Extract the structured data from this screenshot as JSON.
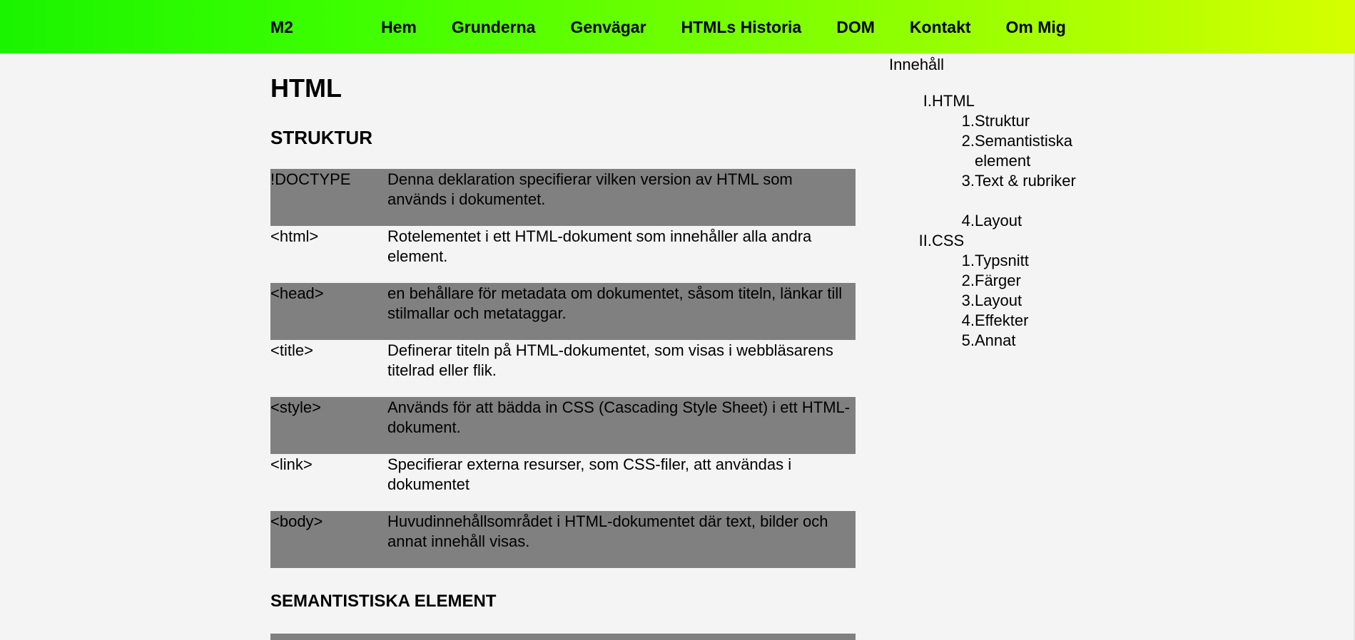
{
  "header": {
    "logo": "M2",
    "nav": [
      "Hem",
      "Grunderna",
      "Genvägar",
      "HTMLs Historia",
      "DOM",
      "Kontakt",
      "Om Mig"
    ]
  },
  "main": {
    "title": "HTML",
    "section1_heading": "STRUKTUR",
    "rows": [
      {
        "tag": "!DOCTYPE",
        "desc": "Denna deklaration specifierar vilken version av HTML som används i dokumentet."
      },
      {
        "tag": "<html>",
        "desc": "Rotelementet i ett HTML-dokument som innehåller alla andra element."
      },
      {
        "tag": "<head>",
        "desc": "en behållare för metadata om dokumentet, såsom titeln, länkar till stilmallar och metataggar."
      },
      {
        "tag": "<title>",
        "desc": "Definerar titeln på HTML-dokumentet, som visas i webbläsarens titelrad eller flik."
      },
      {
        "tag": "<style>",
        "desc": "Används för att bädda in CSS (Cascading Style Sheet) i ett HTML-dokument."
      },
      {
        "tag": "<link>",
        "desc": "Specifierar externa resurser, som CSS-filer, att användas i dokumentet"
      },
      {
        "tag": "<body>",
        "desc": "Huvudinnehållsområdet i HTML-dokumentet där text, bilder och annat innehåll visas."
      }
    ],
    "section2_heading": "SEMANTISTISKA ELEMENT"
  },
  "toc": {
    "title": "Innehåll",
    "sections": [
      {
        "num": "I.",
        "label": "HTML",
        "items": [
          {
            "num": "1.",
            "label": "Struktur"
          },
          {
            "num": "2.",
            "label": "Semantistiska element"
          },
          {
            "num": "3.",
            "label": "Text & rubriker"
          },
          {
            "num": "4.",
            "label": "Layout"
          }
        ]
      },
      {
        "num": "II.",
        "label": "CSS",
        "items": [
          {
            "num": "1.",
            "label": "Typsnitt"
          },
          {
            "num": "2.",
            "label": "Färger"
          },
          {
            "num": "3.",
            "label": "Layout"
          },
          {
            "num": "4.",
            "label": "Effekter"
          },
          {
            "num": "5.",
            "label": "Annat"
          }
        ]
      }
    ]
  }
}
